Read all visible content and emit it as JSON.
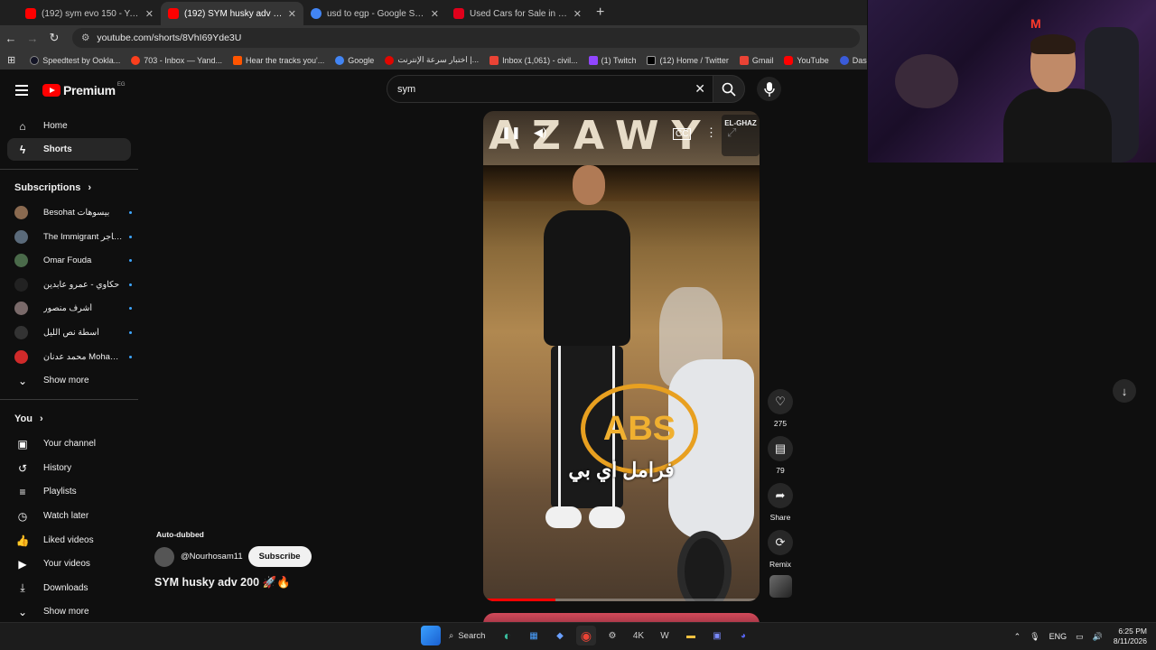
{
  "browser": {
    "tabs": [
      {
        "title": "(192) sym evo 150 - YouTube",
        "favicon_color": "#ff0000",
        "active": false
      },
      {
        "title": "(192) SYM husky adv 200 🚀🔥",
        "favicon_color": "#ff0000",
        "active": true
      },
      {
        "title": "usd to egp - Google Search",
        "favicon_color": "#4285f4",
        "active": false
      },
      {
        "title": "Used Cars for Sale in Dubai | dubizzle",
        "favicon_color": "#e0001b",
        "active": false
      }
    ],
    "url": "youtube.com/shorts/8VhI69Yde3U",
    "bookmarks": [
      {
        "label": "Speedtest by Ookla...",
        "color": "#141526"
      },
      {
        "label": "703 - Inbox — Yand...",
        "color": "#fc3f1d"
      },
      {
        "label": "Hear the tracks you'...",
        "color": "#ff5500"
      },
      {
        "label": "Google",
        "color": "#4285f4"
      },
      {
        "label": "اختبار سرعة الإنترنت |...",
        "color": "#e10600"
      },
      {
        "label": "Inbox (1,061) - civil...",
        "color": "#ea4335"
      },
      {
        "label": "(1) Twitch",
        "color": "#9146ff"
      },
      {
        "label": "(12) Home / Twitter",
        "color": "#000000"
      },
      {
        "label": "Gmail",
        "color": "#ea4335"
      },
      {
        "label": "YouTube",
        "color": "#ff0000"
      },
      {
        "label": "Dashboard - Restre...",
        "color": "#3a5bd9"
      }
    ]
  },
  "youtube": {
    "logo": "Premium",
    "country": "EG",
    "search_value": "sym",
    "nav": [
      {
        "label": "Home",
        "icon": "home-icon"
      },
      {
        "label": "Shorts",
        "icon": "shorts-icon"
      }
    ],
    "subscriptions_label": "Subscriptions",
    "subscriptions": [
      {
        "name": "Besohat بيسوهات",
        "color": "#8a6a50"
      },
      {
        "name": "The Immigrant ـ المهاجر",
        "color": "#5a6a7a"
      },
      {
        "name": "Omar Fouda",
        "color": "#4a6a4a"
      },
      {
        "name": "حكاوي - عمرو عابدين",
        "color": "#222222"
      },
      {
        "name": "أشرف منصور",
        "color": "#7a6a6a"
      },
      {
        "name": "أسطة نص الليل",
        "color": "#333333"
      },
      {
        "name": "محمد عدنان Moham...",
        "color": "#d02a2a"
      }
    ],
    "show_more": "Show more",
    "you_label": "You",
    "you_items": [
      {
        "label": "Your channel",
        "icon": "channel-icon"
      },
      {
        "label": "History",
        "icon": "history-icon"
      },
      {
        "label": "Playlists",
        "icon": "playlists-icon"
      },
      {
        "label": "Watch later",
        "icon": "watch-later-icon"
      },
      {
        "label": "Liked videos",
        "icon": "like-icon"
      },
      {
        "label": "Your videos",
        "icon": "your-videos-icon"
      },
      {
        "label": "Downloads",
        "icon": "download-icon"
      }
    ],
    "show_more_2": "Show more",
    "short": {
      "auto_dubbed": "Auto-dubbed",
      "channel": "@Nourhosam11",
      "subscribe": "Subscribe",
      "title": "SYM husky adv 200 🚀🔥",
      "overlay_brand": "EL-GHAZ",
      "sign_text": "AZAWY",
      "abs_text": "ABS",
      "arabic_caption": "فرامل اي بي",
      "progress": 0.26
    },
    "actions": {
      "likes": "275",
      "comments": "79",
      "share": "Share",
      "remix": "Remix"
    }
  },
  "taskbar": {
    "search": "Search",
    "lang": "ENG",
    "time": "6:25 PM",
    "date": "8/11/2026"
  }
}
